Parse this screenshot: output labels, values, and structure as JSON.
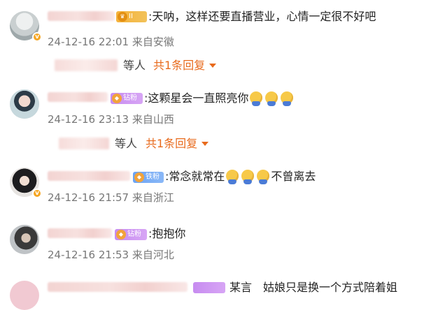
{
  "comments": [
    {
      "badge": "II",
      "badge_kind": "crown",
      "text": "天呐，这样还要直播营业，心情一定很不好吧",
      "time": "24-12-16 22:01",
      "source": "来自安徽",
      "reply_who": "等人",
      "reply_count": "共1条回复"
    },
    {
      "badge": "钻粉2",
      "badge_kind": "diamond",
      "text": "这颗星会一直照亮你",
      "time": "24-12-16 23:13",
      "source": "来自山西",
      "reply_who": "等人",
      "reply_count": "共1条回复"
    },
    {
      "badge": "铁粉4",
      "badge_kind": "iron",
      "text_before": "常念就常在",
      "text_after": "不曾离去",
      "time": "24-12-16 21:57",
      "source": "来自浙江"
    },
    {
      "badge": "钻粉3",
      "badge_kind": "diamond",
      "text": "抱抱你",
      "time": "24-12-16 21:53",
      "source": "来自河北"
    },
    {
      "text_partial": "某言　姑娘只是换一个方式陪着姐"
    }
  ],
  "colors": {
    "reply_accent": "#e86a1c",
    "meta": "#777777",
    "diamond_badge": "#c78cf0",
    "iron_badge": "#6aa3f5",
    "crown_badge": "#f5b23a"
  }
}
